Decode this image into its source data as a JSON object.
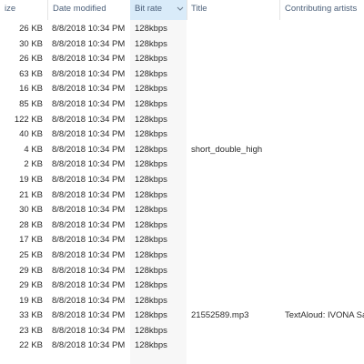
{
  "columns": {
    "size": "ize",
    "date_modified": "Date modified",
    "bit_rate": "Bit rate",
    "title": "Title",
    "contributing_artists": "Contributing artists"
  },
  "sorted_column_color": "#d9ebf9",
  "sort_indicator_icon": "chevron-down-icon",
  "rows": [
    {
      "size": "26 KB",
      "date": "8/8/2018 10:34 PM",
      "bitrate": "128kbps",
      "title": "",
      "artist": ""
    },
    {
      "size": "30 KB",
      "date": "8/8/2018 10:34 PM",
      "bitrate": "128kbps",
      "title": "",
      "artist": ""
    },
    {
      "size": "26 KB",
      "date": "8/8/2018 10:34 PM",
      "bitrate": "128kbps",
      "title": "",
      "artist": ""
    },
    {
      "size": "63 KB",
      "date": "8/8/2018 10:34 PM",
      "bitrate": "128kbps",
      "title": "",
      "artist": ""
    },
    {
      "size": "16 KB",
      "date": "8/8/2018 10:34 PM",
      "bitrate": "128kbps",
      "title": "",
      "artist": ""
    },
    {
      "size": "85 KB",
      "date": "8/8/2018 10:34 PM",
      "bitrate": "128kbps",
      "title": "",
      "artist": ""
    },
    {
      "size": "122 KB",
      "date": "8/8/2018 10:34 PM",
      "bitrate": "128kbps",
      "title": "",
      "artist": ""
    },
    {
      "size": "40 KB",
      "date": "8/8/2018 10:34 PM",
      "bitrate": "128kbps",
      "title": "",
      "artist": ""
    },
    {
      "size": "4 KB",
      "date": "8/8/2018 10:34 PM",
      "bitrate": "128kbps",
      "title": "short_double_high",
      "artist": ""
    },
    {
      "size": "2 KB",
      "date": "8/8/2018 10:34 PM",
      "bitrate": "128kbps",
      "title": "",
      "artist": ""
    },
    {
      "size": "19 KB",
      "date": "8/8/2018 10:34 PM",
      "bitrate": "128kbps",
      "title": "",
      "artist": ""
    },
    {
      "size": "21 KB",
      "date": "8/8/2018 10:34 PM",
      "bitrate": "128kbps",
      "title": "",
      "artist": ""
    },
    {
      "size": "30 KB",
      "date": "8/8/2018 10:34 PM",
      "bitrate": "128kbps",
      "title": "",
      "artist": ""
    },
    {
      "size": "28 KB",
      "date": "8/8/2018 10:34 PM",
      "bitrate": "128kbps",
      "title": "",
      "artist": ""
    },
    {
      "size": "17 KB",
      "date": "8/8/2018 10:34 PM",
      "bitrate": "128kbps",
      "title": "",
      "artist": ""
    },
    {
      "size": "25 KB",
      "date": "8/8/2018 10:34 PM",
      "bitrate": "128kbps",
      "title": "",
      "artist": ""
    },
    {
      "size": "29 KB",
      "date": "8/8/2018 10:34 PM",
      "bitrate": "128kbps",
      "title": "",
      "artist": ""
    },
    {
      "size": "29 KB",
      "date": "8/8/2018 10:34 PM",
      "bitrate": "128kbps",
      "title": "",
      "artist": ""
    },
    {
      "size": "19 KB",
      "date": "8/8/2018 10:34 PM",
      "bitrate": "128kbps",
      "title": "",
      "artist": ""
    },
    {
      "size": "33 KB",
      "date": "8/8/2018 10:34 PM",
      "bitrate": "128kbps",
      "title": "21552589.mp3",
      "artist": "TextAloud: IVONA Sal"
    },
    {
      "size": "23 KB",
      "date": "8/8/2018 10:34 PM",
      "bitrate": "128kbps",
      "title": "",
      "artist": ""
    },
    {
      "size": "22 KB",
      "date": "8/8/2018 10:34 PM",
      "bitrate": "128kbps",
      "title": "",
      "artist": ""
    }
  ]
}
